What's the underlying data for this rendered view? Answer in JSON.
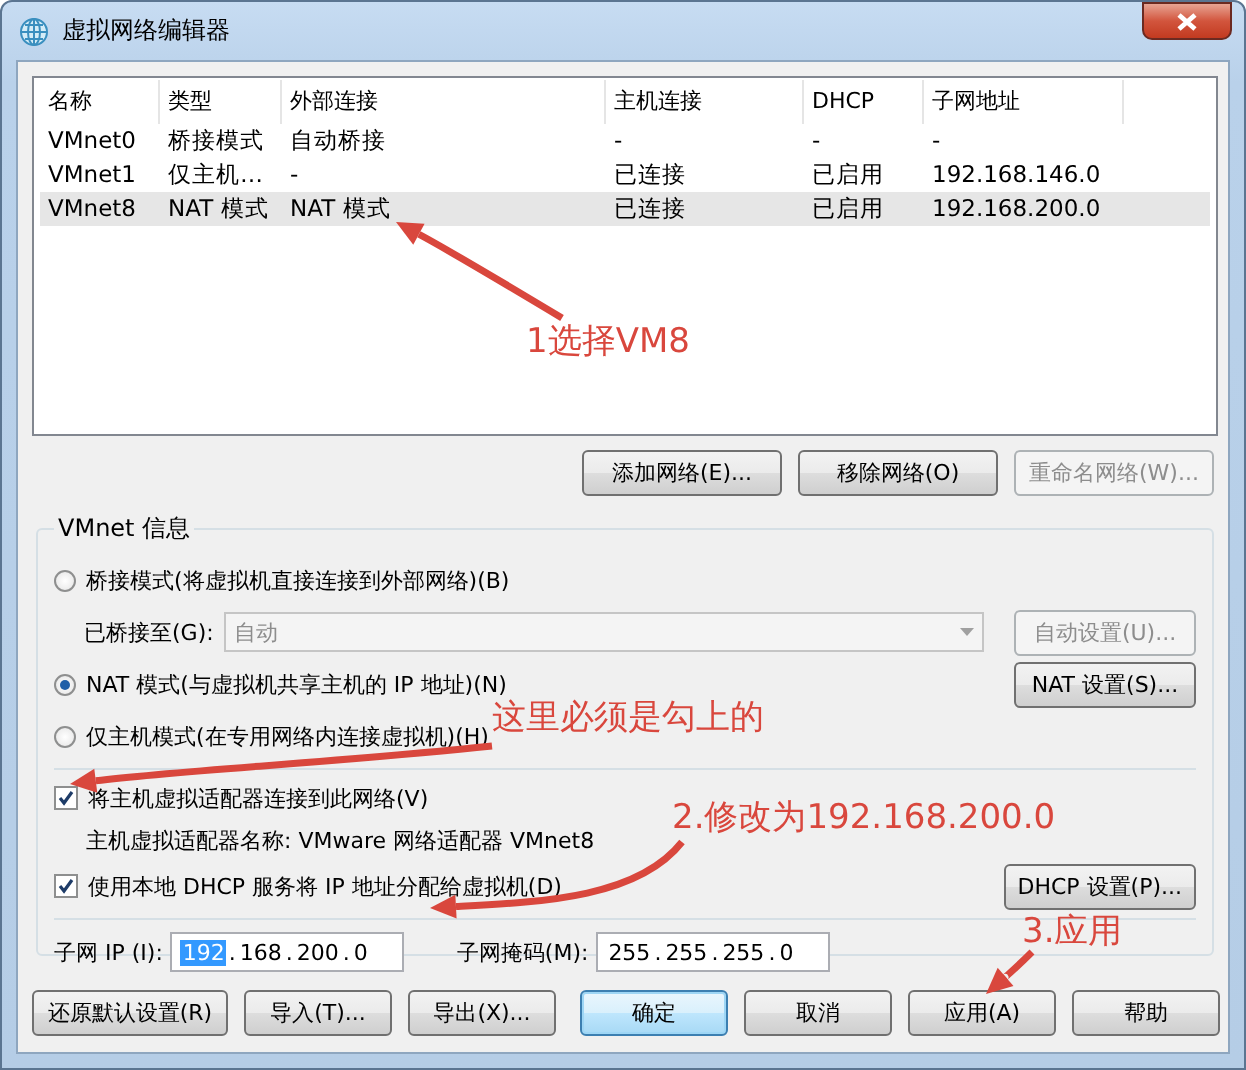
{
  "window": {
    "title": "虚拟网络编辑器"
  },
  "table": {
    "columns": [
      "名称",
      "类型",
      "外部连接",
      "主机连接",
      "DHCP",
      "子网地址"
    ],
    "rows": [
      {
        "cells": [
          "VMnet0",
          "桥接模式",
          "自动桥接",
          "-",
          "-",
          "-"
        ],
        "selected": false
      },
      {
        "cells": [
          "VMnet1",
          "仅主机…",
          "-",
          "已连接",
          "已启用",
          "192.168.146.0"
        ],
        "selected": false
      },
      {
        "cells": [
          "VMnet8",
          "NAT 模式",
          "NAT 模式",
          "已连接",
          "已启用",
          "192.168.200.0"
        ],
        "selected": true
      }
    ]
  },
  "network_buttons": [
    {
      "label": "添加网络(E)...",
      "disabled": false
    },
    {
      "label": "移除网络(O)",
      "disabled": false
    },
    {
      "label": "重命名网络(W)...",
      "disabled": true
    }
  ],
  "vmnet_info": {
    "title": "VMnet 信息",
    "modes": [
      {
        "label": "桥接模式(将虚拟机直接连接到外部网络)(B)",
        "selected": false
      },
      {
        "label": "NAT 模式(与虚拟机共享主机的 IP 地址)(N)",
        "selected": true
      },
      {
        "label": "仅主机模式(在专用网络内连接虚拟机)(H)",
        "selected": false
      }
    ],
    "bridged_to": {
      "label": "已桥接至(G):",
      "value": "自动",
      "disabled": true
    },
    "auto_settings_button": {
      "label": "自动设置(U)...",
      "disabled": true
    },
    "nat_settings_button": {
      "label": "NAT 设置(S)...",
      "disabled": false
    },
    "connect_adapter": {
      "label": "将主机虚拟适配器连接到此网络(V)",
      "checked": true
    },
    "adapter_name": "主机虚拟适配器名称: VMware 网络适配器 VMnet8",
    "use_dhcp": {
      "label": "使用本地 DHCP 服务将 IP 地址分配给虚拟机(D)",
      "checked": true
    },
    "dhcp_settings_button": {
      "label": "DHCP 设置(P)...",
      "disabled": false
    },
    "subnet_ip": {
      "label": "子网 IP (I):",
      "separator": ".",
      "octets": [
        {
          "text": "192",
          "selected": true
        },
        {
          "text": "168",
          "selected": false
        },
        {
          "text": "200",
          "selected": false
        },
        {
          "text": "0",
          "selected": false
        }
      ]
    },
    "subnet_mask": {
      "label": "子网掩码(M):",
      "separator": ".",
      "octets": [
        {
          "text": "255",
          "selected": false
        },
        {
          "text": "255",
          "selected": false
        },
        {
          "text": "255",
          "selected": false
        },
        {
          "text": "0",
          "selected": false
        }
      ]
    }
  },
  "footer_buttons": [
    {
      "label": "还原默认设置(R)",
      "default": false
    },
    {
      "label": "导入(T)...",
      "default": false
    },
    {
      "label": "导出(X)...",
      "default": false
    },
    {
      "label": "确定",
      "default": true
    },
    {
      "label": "取消",
      "default": false
    },
    {
      "label": "应用(A)",
      "default": false
    },
    {
      "label": "帮助",
      "default": false
    }
  ],
  "annotations": [
    {
      "text": "1选择VM8"
    },
    {
      "text": "这里必须是勾上的"
    },
    {
      "text": "2.修改为192.168.200.0"
    },
    {
      "text": "3.应用"
    }
  ]
}
